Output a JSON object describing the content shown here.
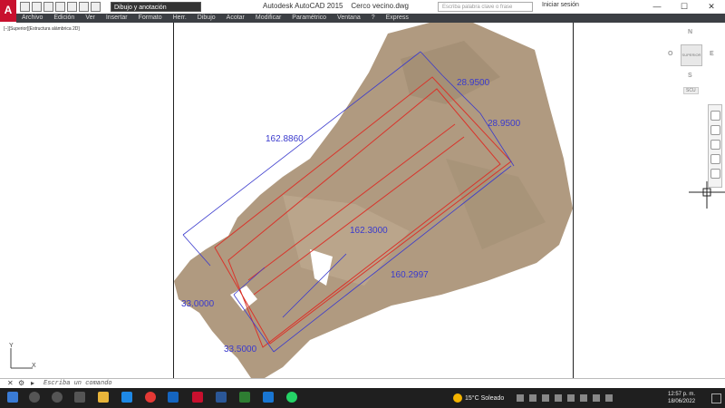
{
  "window": {
    "title": "Autodesk AutoCAD 2015",
    "file": "Cerco vecino.dwg",
    "workspace": "Dibujo y anotación",
    "search_placeholder": "Escriba palabra clave o frase",
    "signin": "Iniciar sesión"
  },
  "menu": [
    "Archivo",
    "Edición",
    "Ver",
    "Insertar",
    "Formato",
    "Herr.",
    "Dibujo",
    "Acotar",
    "Modificar",
    "Paramétrico",
    "Ventana",
    "?",
    "Express"
  ],
  "viewport_label": "[−][Superior][Estructura alámbrica 2D]",
  "dimensions": {
    "d1": "162.8860",
    "d2": "28.9500",
    "d3": "28.9500",
    "d4": "162.3000",
    "d5": "160.2997",
    "d6": "33.0000",
    "d7": "33.5000"
  },
  "navcube": {
    "north": "N",
    "south": "S",
    "west": "O",
    "east": "E",
    "face": "SUPERIOR",
    "ucs": "SCU"
  },
  "ucs_axis": {
    "y": "Y",
    "x": "X"
  },
  "command": {
    "placeholder": "Escriba un comando"
  },
  "taskbar": {
    "weather": "15°C  Soleado",
    "time": "12:57 p. m.",
    "date": "18/06/2022"
  },
  "colors": {
    "dim": "#3a3acd",
    "red": "#d9342b",
    "terrain": "#b09a80",
    "menubar": "#3c3f44",
    "taskbar": "#1f1f1f"
  }
}
